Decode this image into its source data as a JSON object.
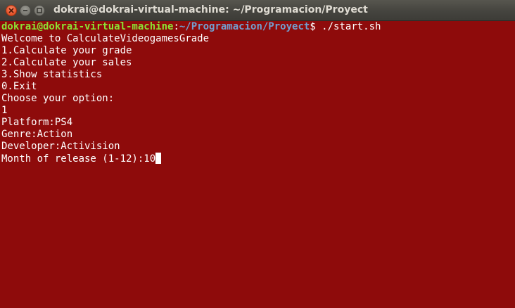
{
  "window": {
    "title": "dokrai@dokrai-virtual-machine: ~/Programacion/Proyect"
  },
  "terminal": {
    "prompt_user_host": "dokrai@dokrai-virtual-machine",
    "prompt_colon": ":",
    "prompt_path": "~/Programacion/Proyect",
    "prompt_symbol": "$ ",
    "command": "./start.sh",
    "output_lines": [
      "Welcome to CalculateVideogamesGrade",
      "1.Calculate your grade",
      "2.Calculate your sales",
      "3.Show statistics",
      "0.Exit",
      "Choose your option:",
      "1",
      "Platform:PS4",
      "Genre:Action",
      "Developer:Activision"
    ],
    "current_input_prompt": "Month of release (1-12):",
    "current_input_value": "10"
  },
  "colors": {
    "background": "#8e0b0b",
    "text": "#ffffff",
    "prompt_user": "#8ae234",
    "prompt_path": "#729fcf"
  }
}
